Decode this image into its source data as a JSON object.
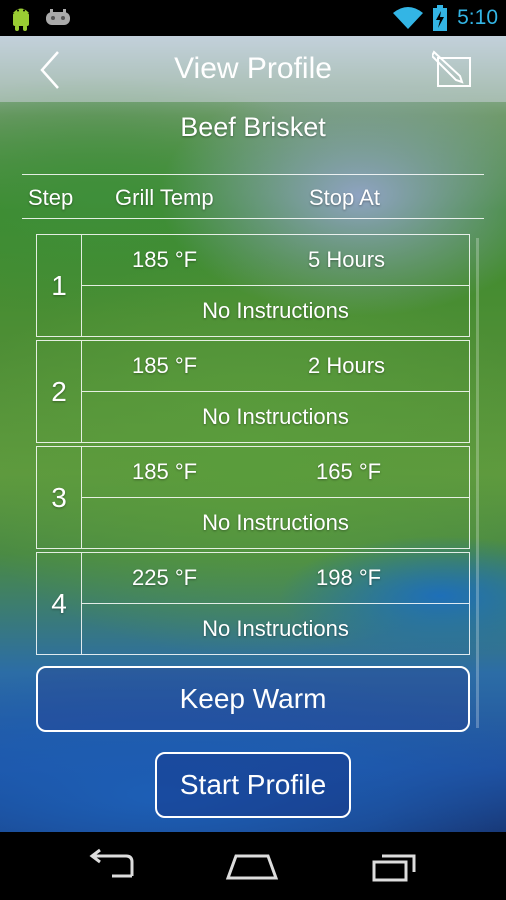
{
  "status_bar": {
    "time": "5:10",
    "icons": [
      "android-icon",
      "game-controller-icon",
      "wifi-icon",
      "battery-charging-icon"
    ]
  },
  "action_bar": {
    "title": "View Profile",
    "back_icon": "chevron-left-icon",
    "edit_icon": "edit-icon"
  },
  "profile": {
    "name": "Beef Brisket"
  },
  "table": {
    "headers": [
      "Step",
      "Grill Temp",
      "Stop At"
    ],
    "steps": [
      {
        "num": "1",
        "grill_temp": "185 °F",
        "stop_at": "5 Hours",
        "instructions": "No Instructions"
      },
      {
        "num": "2",
        "grill_temp": "185 °F",
        "stop_at": "2 Hours",
        "instructions": "No Instructions"
      },
      {
        "num": "3",
        "grill_temp": "185 °F",
        "stop_at": "165 °F",
        "instructions": "No Instructions"
      },
      {
        "num": "4",
        "grill_temp": "225 °F",
        "stop_at": "198 °F",
        "instructions": "No Instructions"
      }
    ]
  },
  "buttons": {
    "keep_warm": "Keep Warm",
    "start_profile": "Start Profile"
  },
  "nav_bar": {
    "icons": [
      "back-arrow-icon",
      "home-icon",
      "recent-apps-icon"
    ]
  }
}
